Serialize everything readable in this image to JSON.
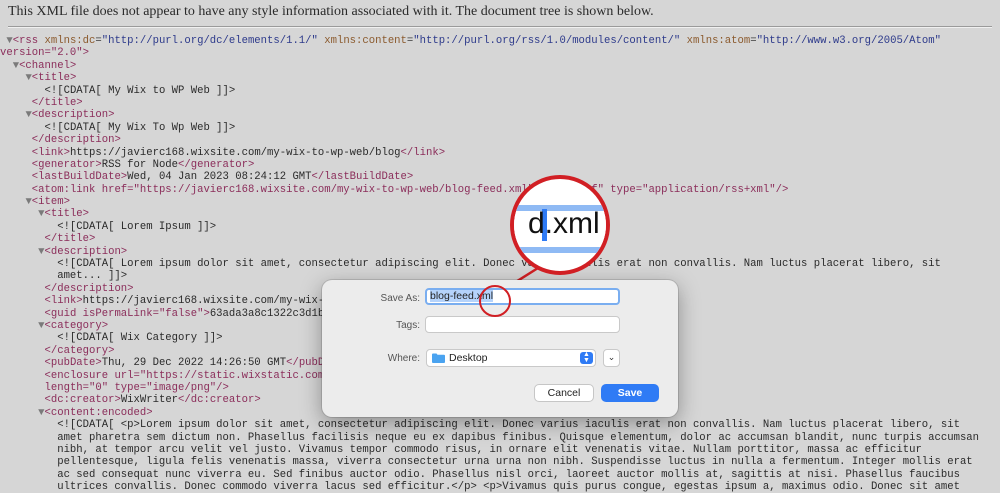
{
  "notice": "This XML file does not appear to have any style information associated with it. The document tree is shown below.",
  "xml": {
    "rss_open": {
      "tag": "<rss",
      "attrs": [
        {
          "name": "xmlns:dc",
          "value": "\"http://purl.org/dc/elements/1.1/\""
        },
        {
          "name": "xmlns:content",
          "value": "\"http://purl.org/rss/1.0/modules/content/\""
        },
        {
          "name": "xmlns:atom",
          "value": "\"http://www.w3.org/2005/Atom\""
        }
      ],
      "version_line": "version=\"2.0\">"
    },
    "lines": [
      {
        "indent": 1,
        "tri": "▼",
        "tag": "<channel>"
      },
      {
        "indent": 2,
        "tri": "▼",
        "tag": "<title>"
      },
      {
        "indent": 3,
        "text": "<![CDATA[ My Wix to WP Web ]]>"
      },
      {
        "indent": 2,
        "tag": "</title>"
      },
      {
        "indent": 2,
        "tri": "▼",
        "tag": "<description>"
      },
      {
        "indent": 3,
        "text": "<![CDATA[ My Wix To Wp Web ]]>"
      },
      {
        "indent": 2,
        "tag": "</description>"
      },
      {
        "indent": 2,
        "tag": "<link>",
        "text": "https://javierc168.wixsite.com/my-wix-to-wp-web/blog",
        "close": "</link>"
      },
      {
        "indent": 2,
        "tag": "<generator>",
        "text": "RSS for Node",
        "close": "</generator>"
      },
      {
        "indent": 2,
        "tag": "<lastBuildDate>",
        "text": "Wed, 04 Jan 2023 08:24:12 GMT",
        "close": "</lastBuildDate>"
      },
      {
        "indent": 2,
        "tag": "<atom:link href=\"https://javierc168.wixsite.com/my-wix-to-wp-web/blog-feed.xml\" rel=\"self\" type=\"application/rss+xml\"/>"
      },
      {
        "indent": 2,
        "tri": "▼",
        "tag": "<item>"
      },
      {
        "indent": 3,
        "tri": "▼",
        "tag": "<title>"
      },
      {
        "indent": 4,
        "text": "<![CDATA[ Lorem Ipsum ]]>"
      },
      {
        "indent": 3,
        "tag": "</title>"
      },
      {
        "indent": 3,
        "tri": "▼",
        "tag": "<description>"
      },
      {
        "indent": 4,
        "text": "<![CDATA[ Lorem ipsum dolor sit amet, consectetur adipiscing elit. Donec varius iaculis erat non convallis. Nam luctus placerat libero, sit"
      },
      {
        "indent": 4,
        "text": "amet... ]]>"
      },
      {
        "indent": 3,
        "tag": "</description>"
      },
      {
        "indent": 3,
        "tag": "<link>",
        "text": "https://javierc168.wixsite.com/my-wix-to-wp-web/post/lorem-ipsum",
        "close": "</link>"
      },
      {
        "indent": 3,
        "tag": "<guid isPermaLink=\"false\">",
        "text": "63ada3a8c1322c3d1b6d9a41",
        "close": "</guid>"
      },
      {
        "indent": 3,
        "tri": "▼",
        "tag": "<category>"
      },
      {
        "indent": 4,
        "text": "<![CDATA[ Wix Category ]]>"
      },
      {
        "indent": 3,
        "tag": "</category>"
      },
      {
        "indent": 3,
        "tag": "<pubDate>",
        "text": "Thu, 29 Dec 2022 14:26:50 GMT",
        "close": "</pubDate>"
      },
      {
        "indent": 3,
        "tag": "<enclosure url=\"https://static.wixstatic.com/media/....../v1/fit/w_1000,h_975,al_c,q_80/file.png\""
      },
      {
        "indent": 3,
        "tag": "length=\"0\" type=\"image/png\"/>"
      },
      {
        "indent": 3,
        "tag": "<dc:creator>",
        "text": "WixWriter",
        "close": "</dc:creator>"
      },
      {
        "indent": 3,
        "tri": "▼",
        "tag": "<content:encoded>"
      },
      {
        "indent": 4,
        "text": "<![CDATA[ <p>Lorem ipsum dolor sit amet, consectetur adipiscing elit. Donec varius iaculis erat non convallis. Nam luctus placerat libero, sit"
      },
      {
        "indent": 4,
        "text": "amet pharetra sem dictum non. Phasellus facilisis neque eu ex dapibus finibus. Quisque elementum, dolor ac accumsan blandit, nunc turpis accumsan"
      },
      {
        "indent": 4,
        "text": "nibh, at tempor arcu velit vel justo. Vivamus tempor commodo risus, in ornare elit venenatis vitae. Nullam porttitor, massa ac efficitur"
      },
      {
        "indent": 4,
        "text": "pellentesque, ligula felis venenatis massa, viverra consectetur urna urna non nibh. Suspendisse luctus in nulla a fermentum. Integer mollis erat"
      },
      {
        "indent": 4,
        "text": "ac sed consequat nunc viverra eu. Sed finibus auctor odio. Phasellus nisl orci, laoreet auctor mollis at, sagittis at nisi. Phasellus faucibus"
      },
      {
        "indent": 4,
        "text": "ultrices convallis. Donec commodo viverra lacus sed efficitur.</p> <p>Vivamus quis purus congue, egestas ipsum a, maximus odio. Donec sit amet"
      }
    ]
  },
  "dialog": {
    "save_as_label": "Save As:",
    "save_as_value": "blog-feed.xml",
    "tags_label": "Tags:",
    "tags_value": "",
    "where_label": "Where:",
    "where_value": "Desktop",
    "cancel_label": "Cancel",
    "save_label": "Save",
    "accent_color": "#2f7bf5"
  },
  "magnifier": {
    "zoom_text": "d.xml",
    "ring_color": "#d11f24"
  }
}
